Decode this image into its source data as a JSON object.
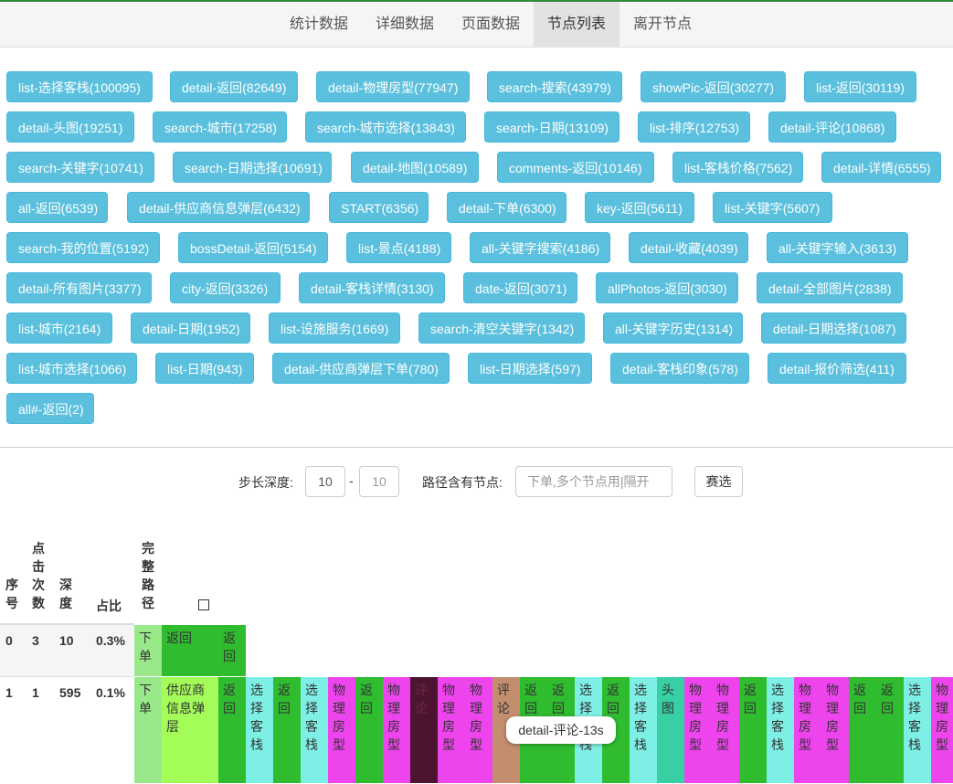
{
  "nav": {
    "tabs": [
      {
        "label": "统计数据"
      },
      {
        "label": "详细数据"
      },
      {
        "label": "页面数据"
      },
      {
        "label": "节点列表",
        "active": true
      },
      {
        "label": "离开节点"
      }
    ]
  },
  "nodes": [
    "list-选择客栈(100095)",
    "detail-返回(82649)",
    "detail-物理房型(77947)",
    "search-搜索(43979)",
    "showPic-返回(30277)",
    "list-返回(30119)",
    "detail-头图(19251)",
    "search-城市(17258)",
    "search-城市选择(13843)",
    "search-日期(13109)",
    "list-排序(12753)",
    "detail-评论(10868)",
    "search-关键字(10741)",
    "search-日期选择(10691)",
    "detail-地图(10589)",
    "comments-返回(10146)",
    "list-客栈价格(7562)",
    "detail-详情(6555)",
    "all-返回(6539)",
    "detail-供应商信息弹层(6432)",
    "START(6356)",
    "detail-下单(6300)",
    "key-返回(5611)",
    "list-关键字(5607)",
    "search-我的位置(5192)",
    "bossDetail-返回(5154)",
    "list-景点(4188)",
    "all-关键字搜索(4186)",
    "detail-收藏(4039)",
    "all-关键字输入(3613)",
    "detail-所有图片(3377)",
    "city-返回(3326)",
    "detail-客栈详情(3130)",
    "date-返回(3071)",
    "allPhotos-返回(3030)",
    "detail-全部图片(2838)",
    "list-城市(2164)",
    "detail-日期(1952)",
    "list-设施服务(1669)",
    "search-清空关键字(1342)",
    "all-关键字历史(1314)",
    "detail-日期选择(1087)",
    "list-城市选择(1066)",
    "list-日期(943)",
    "detail-供应商弹层下单(780)",
    "list-日期选择(597)",
    "detail-客栈印象(578)",
    "detail-报价筛选(411)",
    "all#-返回(2)"
  ],
  "filter": {
    "depth_label": "步长深度:",
    "depth_from": "10",
    "depth_dash": "-",
    "depth_to": "10",
    "path_label": "路径含有节点:",
    "path_placeholder": "下单,多个节点用|隔开",
    "search_button": "赛选"
  },
  "table": {
    "headers": {
      "index": "序号",
      "clicks": "点击次数",
      "depth": "深度",
      "ratio": "占比",
      "full_path": "完整路径"
    },
    "rows": [
      {
        "index": "0",
        "clicks": "3",
        "depth": "10",
        "ratio": "0.3%",
        "steps": [
          "下单",
          "返回",
          "返回"
        ]
      },
      {
        "index": "1",
        "clicks": "1",
        "depth": "595",
        "ratio": "0.1%",
        "steps": [
          "下单",
          "供应商信息弹层",
          "返回",
          "选择客栈",
          "返回",
          "选择客栈",
          "物理房型",
          "返回",
          "物理房型",
          "评论",
          "物理房型",
          "物理房型",
          "评论",
          "返回",
          "返回",
          "选择客栈",
          "返回",
          "选择客栈",
          "头图",
          "物理房型",
          "物理房型",
          "返回",
          "选择客栈",
          "物理房型",
          "物理房型",
          "返回",
          "返回",
          "选择客栈",
          "物理房型"
        ]
      }
    ]
  },
  "tooltip": "detail-评论-13s",
  "colors": {
    "node_button": "#5bc0de",
    "bar_green": "#2fbc2f",
    "bar_light_green": "#99e98a",
    "bar_lime": "#a3fc57",
    "bar_cyan": "#7eefe4",
    "bar_magenta": "#ee44ee",
    "bar_dark_maroon": "#4c1430",
    "bar_tan": "#c28e6e",
    "bar_teal": "#37cfa4"
  }
}
